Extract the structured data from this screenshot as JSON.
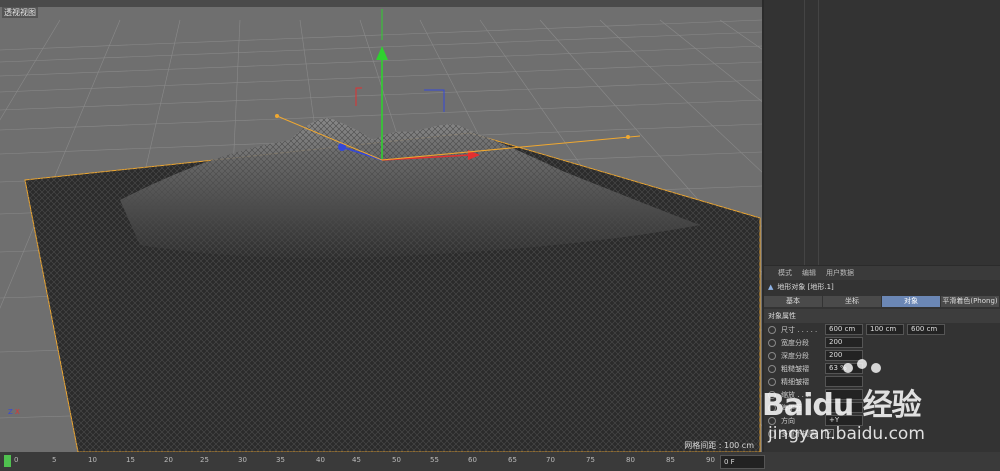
{
  "viewport": {
    "label": "透视视图",
    "grid_spacing": "网格间距 : 100 cm"
  },
  "attributes": {
    "menu": [
      "模式",
      "编辑",
      "用户数据"
    ],
    "title": "地形对象 [地形.1]",
    "tabs": [
      "基本",
      "坐标",
      "对象",
      "平滑着色(Phong)"
    ],
    "active_tab": "对象",
    "section": "对象属性",
    "rows": [
      {
        "label": "尺寸 . . . . .",
        "values": [
          "600 cm",
          "100 cm",
          "600 cm"
        ]
      },
      {
        "label": "宽度分段",
        "values": [
          "200"
        ]
      },
      {
        "label": "深度分段",
        "values": [
          "200"
        ]
      },
      {
        "label": "粗糙皱褶",
        "values": [
          "63 %"
        ]
      },
      {
        "label": "精细皱褶",
        "values": [
          ""
        ]
      },
      {
        "label": "缩放 . . .",
        "values": [
          ""
        ]
      },
      {
        "label": "海平面",
        "values": [
          ""
        ]
      },
      {
        "label": "方向",
        "values": [
          "+Y"
        ]
      }
    ],
    "checkbox_label": "多重不规则",
    "checkbox_checked": "✓"
  },
  "timeline": {
    "ticks": [
      "0",
      "5",
      "10",
      "15",
      "20",
      "25",
      "30",
      "35",
      "40",
      "45",
      "50",
      "55",
      "60",
      "65",
      "70",
      "75",
      "80",
      "85",
      "90"
    ],
    "current_frame": "0 F"
  },
  "watermark": {
    "brand": "Baidu 经验",
    "url": "jingyan.baidu.com"
  }
}
